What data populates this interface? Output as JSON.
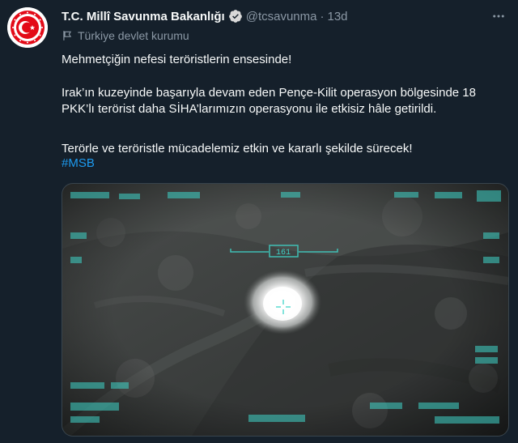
{
  "account": {
    "name": "T.C. Millî Savunma Bakanlığı",
    "handle": "@tcsavunma",
    "separator": "·",
    "time": "13d",
    "label": "Türkiye devlet kurumu"
  },
  "tweet": {
    "line1": "Mehmetçiğin nefesi teröristlerin ensesinde!",
    "line2": "Irak’ın kuzeyinde başarıyla devam eden Pençe-Kilit operasyon bölgesinde 18 PKK’lı terörist daha SİHA’larımızın operasyonu ile etkisiz hâle getirildi.",
    "line3": "Terörle ve teröristle mücadelemiz etkin ve kararlı şekilde sürecek!",
    "hashtag": "#MSB"
  },
  "media": {
    "hud_heading": "161"
  },
  "colors": {
    "background": "#15202b",
    "text": "#f7f9f9",
    "muted": "#8b98a5",
    "link": "#1d9bf0",
    "verified": "#d9d9d9",
    "hud": "#3fd4c8",
    "logo_red": "#e30a17"
  },
  "icons": {
    "verified": "verified-badge-icon",
    "more": "more-options-icon",
    "label": "government-flag-icon"
  }
}
